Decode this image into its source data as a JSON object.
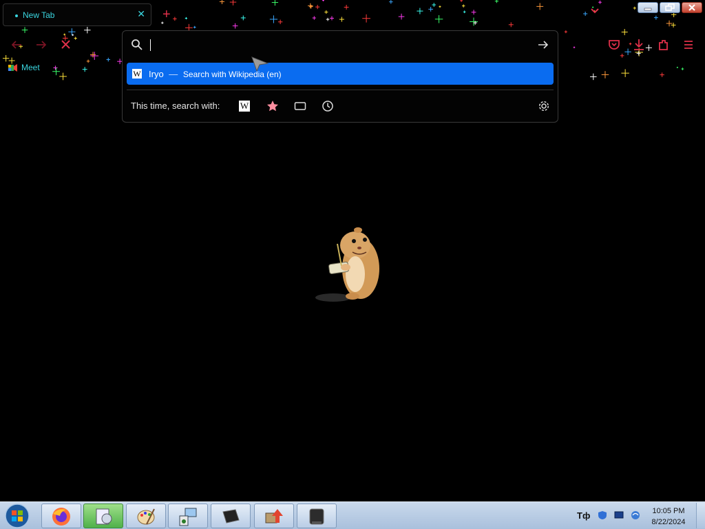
{
  "tab": {
    "title": "New Tab",
    "close_icon": "close-icon"
  },
  "window_controls": [
    "minimize",
    "restore",
    "close"
  ],
  "toolbar": {
    "back_icon": "arrow-left-icon",
    "forward_icon": "arrow-right-icon",
    "stop_icon": "close-icon",
    "right_icons": [
      "pocket-icon",
      "download-icon",
      "extensions-icon",
      "menu-icon"
    ]
  },
  "bookmarks": [
    {
      "label": "Meet",
      "icon": "meet-icon"
    }
  ],
  "urlbar": {
    "value": "",
    "result": {
      "query": "Iryo",
      "separator": "—",
      "action": "Search with Wikipedia (en)",
      "engine_icon": "W"
    },
    "one_off": {
      "label": "This time, search with:",
      "engines": [
        {
          "name": "wikipedia",
          "glyph": "W"
        },
        {
          "name": "bookmarks",
          "icon": "star-icon"
        },
        {
          "name": "tabs",
          "icon": "tab-icon"
        },
        {
          "name": "history",
          "icon": "clock-icon"
        }
      ],
      "settings_icon": "gear-icon"
    }
  },
  "taskbar": {
    "apps": [
      "firefox",
      "media-app",
      "paint",
      "network-setup",
      "dark-app",
      "upload-app",
      "printer-app"
    ],
    "tray_language": "Тф",
    "clock_time": "10:05 PM",
    "clock_date": "8/22/2024"
  },
  "colors": {
    "accent_red": "#e0304a",
    "accent_cyan": "#3ad6e0",
    "selection_blue": "#0a6cf0",
    "background": "#000000"
  }
}
